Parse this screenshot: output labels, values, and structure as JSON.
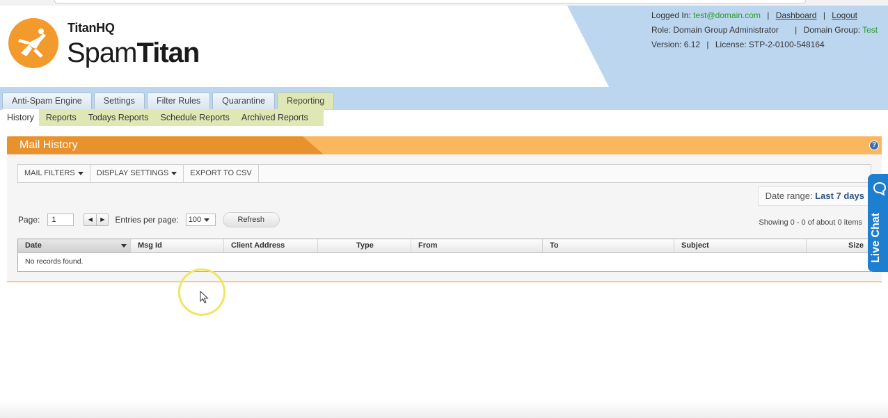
{
  "brand": {
    "company": "TitanHQ",
    "product_light": "Spam",
    "product_bold": "Titan"
  },
  "user_info": {
    "logged_in_label": "Logged In:",
    "email": "test@domain.com",
    "dashboard_link": "Dashboard",
    "logout_link": "Logout",
    "role_label": "Role:",
    "role": "Domain Group Administrator",
    "domain_group_label": "Domain Group:",
    "domain_group": "Test",
    "version_label": "Version:",
    "version": "6.12",
    "license_label": "License:",
    "license": "STP-2-0100-548164"
  },
  "tabs": [
    "Anti-Spam Engine",
    "Settings",
    "Filter Rules",
    "Quarantine",
    "Reporting"
  ],
  "active_tab": "Reporting",
  "subtabs": [
    "History",
    "Reports",
    "Todays Reports",
    "Schedule Reports",
    "Archived Reports"
  ],
  "active_subtab": "History",
  "panel": {
    "title": "Mail History",
    "help_icon": "?",
    "toolbar": {
      "mail_filters": "MAIL FILTERS",
      "display_settings": "DISPLAY SETTINGS",
      "export_csv": "EXPORT TO CSV"
    },
    "date_range_label": "Date range:",
    "date_range_value": "Last 7 days",
    "pager": {
      "page_label": "Page:",
      "page_value": "1",
      "prev_icon": "◀",
      "next_icon": "▶",
      "entries_label": "Entries per page:",
      "entries_value": "100",
      "refresh_label": "Refresh"
    },
    "showing_text": "Showing 0 - 0 of about 0 items",
    "columns": [
      "Date",
      "Msg Id",
      "Client Address",
      "Type",
      "From",
      "To",
      "Subject",
      "Size"
    ],
    "empty_text": "No records found."
  },
  "live_chat": {
    "label": "Live Chat"
  },
  "colors": {
    "accent_orange": "#e8922d",
    "light_orange": "#fbb65e",
    "header_blue": "#bcd6f0",
    "subtab_green": "#dfe8b5",
    "live_chat_blue": "#1e7fd0"
  }
}
